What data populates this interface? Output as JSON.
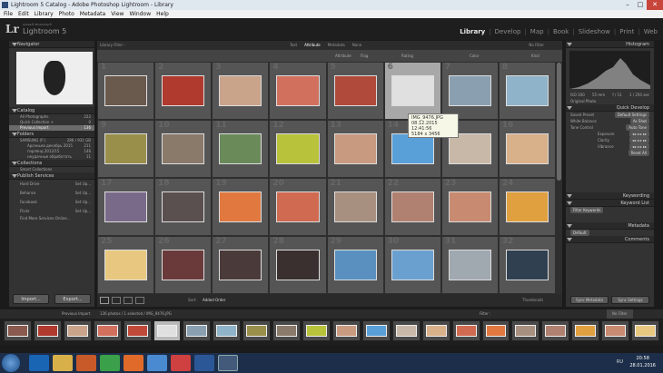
{
  "window": {
    "title": "Lightroom 5 Catalog - Adobe Photoshop Lightroom - Library"
  },
  "menu": [
    "File",
    "Edit",
    "Library",
    "Photo",
    "Metadata",
    "View",
    "Window",
    "Help"
  ],
  "identity": {
    "logo": "Lr",
    "adobe": "Adobe® Photoshop®",
    "product": "Lightroom 5"
  },
  "modules": [
    "Library",
    "Develop",
    "Map",
    "Book",
    "Slideshow",
    "Print",
    "Web"
  ],
  "active_module": "Library",
  "left": {
    "navigator": "Navigator",
    "catalog": {
      "title": "Catalog",
      "items": [
        {
          "label": "All Photographs",
          "count": "222"
        },
        {
          "label": "Quick Collection +",
          "count": "0"
        },
        {
          "label": "Previous Import",
          "count": "136"
        }
      ]
    },
    "folders": {
      "title": "Folders",
      "volume": "SAMSUNG (F:)",
      "volume_info": "286 / 931 GB",
      "items": [
        {
          "label": "Арсеньев декабрь 2015",
          "count": "211"
        },
        {
          "label": "гирлянд 2012/15",
          "count": "146"
        },
        {
          "label": "неудачные обработать",
          "count": "11"
        }
      ]
    },
    "collections": {
      "title": "Collections",
      "items": [
        {
          "label": "Smart Collections"
        }
      ]
    },
    "publish": {
      "title": "Publish Services",
      "items": [
        {
          "label": "Hard Drive",
          "action": "Set Up..."
        },
        {
          "label": "Behance",
          "action": "Set Up..."
        },
        {
          "label": "Facebook",
          "action": "Set Up..."
        },
        {
          "label": "Flickr",
          "action": "Set Up..."
        }
      ],
      "find_more": "Find More Services Online..."
    },
    "import_label": "Import...",
    "export_label": "Export..."
  },
  "filterbar": {
    "label": "Library Filter :",
    "tabs": [
      "Text",
      "Attribute",
      "Metadata",
      "None"
    ],
    "active_tab": "Attribute",
    "preset": "No Filter"
  },
  "attrbar": {
    "attribute": "Attribute",
    "flag": "Flag",
    "rating": "Rating",
    "color": "Color",
    "kind": "Kind"
  },
  "grid": {
    "numbers": [
      1,
      2,
      3,
      4,
      5,
      6,
      7,
      8,
      9,
      10,
      11,
      12,
      13,
      14,
      15,
      16,
      17,
      18,
      19,
      20,
      21,
      22,
      23,
      24,
      25,
      26,
      27,
      28,
      29,
      30,
      31,
      32
    ],
    "selected_index": 5,
    "thumb_colors": [
      "#6a5a4e",
      "#b03a2e",
      "#c9a38a",
      "#d2705e",
      "#b04a3a",
      "#e0e0e0",
      "#8aa0b0",
      "#8fb3c8",
      "#9a8f4a",
      "#8a7a6a",
      "#6a8a5a",
      "#b8c23a",
      "#c89a80",
      "#5aa0d8",
      "#c8b8a8",
      "#d8b08a",
      "#7a6a8a",
      "#5a5050",
      "#e07840",
      "#d06a50",
      "#a89080",
      "#b08070",
      "#c88a70",
      "#e0a040",
      "#e8c880",
      "#6a3a3a",
      "#4a3a3a",
      "#3a3030",
      "#5a90c0",
      "#6aa0d0",
      "#a0a8b0",
      "#304050"
    ]
  },
  "tooltip": {
    "name": "IMG_9476.JPG",
    "date": "08.12.2015 12:41:56",
    "size": "5184 x 3456"
  },
  "toolbar": {
    "sort_label": "Sort:",
    "sort_value": "Added Order",
    "thumbnails": "Thumbnails"
  },
  "right": {
    "histogram": "Histogram",
    "exif": [
      "ISO 100",
      "55 mm",
      "f / 11",
      "1 / 250 sec"
    ],
    "original_photo": "Original Photo",
    "quick_develop": "Quick Develop",
    "saved_preset": {
      "label": "Saved Preset",
      "value": "Default Settings"
    },
    "white_balance": {
      "label": "White Balance",
      "value": "As Shot"
    },
    "tone_control": {
      "label": "Tone Control",
      "value": "Auto Tone"
    },
    "sliders": [
      "Exposure",
      "Clarity",
      "Vibrance"
    ],
    "reset": "Reset All",
    "keywording": "Keywording",
    "keyword_list": "Keyword List",
    "filter_keywords": "Filter Keywords",
    "metadata": "Metadata",
    "metadata_preset": "Default",
    "comments": "Comments",
    "sync_metadata": "Sync Metadata",
    "sync_settings": "Sync Settings"
  },
  "filmstrip": {
    "source": "Previous Import",
    "info": "136 photos / 1 selected / IMG_9476.JPG",
    "filter_label": "Filter :",
    "filter_value": "No Filter",
    "thumb_colors": [
      "#8a5a4e",
      "#b03a2e",
      "#c9a38a",
      "#d2705e",
      "#c04a3a",
      "#e0e0e0",
      "#8aa0b0",
      "#8fb3c8",
      "#9a8f4a",
      "#8a7a6a",
      "#b8c23a",
      "#c89a80",
      "#5aa0d8",
      "#c8b8a8",
      "#d8b08a",
      "#d06a50",
      "#e07840",
      "#a89080",
      "#b08070",
      "#e0a040",
      "#c88a70",
      "#e8c880"
    ],
    "selected_index": 5
  },
  "taskbar": {
    "lang": "RU",
    "time": "20:58",
    "date": "28.01.2016"
  }
}
